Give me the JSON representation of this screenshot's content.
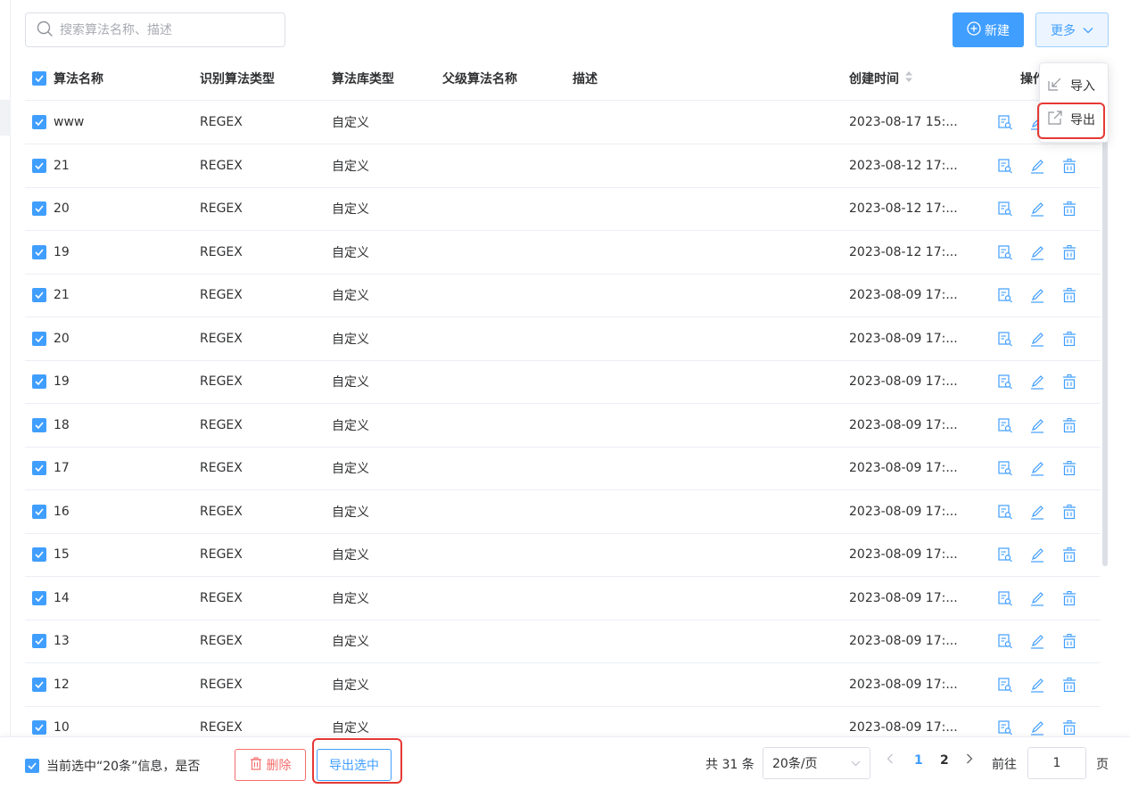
{
  "search": {
    "placeholder": "搜索算法名称、描述"
  },
  "toolbar": {
    "new_label": "新建",
    "more_label": "更多"
  },
  "more_menu": {
    "import_label": "导入",
    "export_label": "导出"
  },
  "table": {
    "columns": [
      "算法名称",
      "识别算法类型",
      "算法库类型",
      "父级算法名称",
      "描述",
      "创建时间",
      "操作"
    ],
    "rows": [
      {
        "name": "www",
        "type": "REGEX",
        "lib": "自定义",
        "parent": "",
        "desc": "",
        "time": "2023-08-17 15:..."
      },
      {
        "name": "21",
        "type": "REGEX",
        "lib": "自定义",
        "parent": "",
        "desc": "",
        "time": "2023-08-12 17:..."
      },
      {
        "name": "20",
        "type": "REGEX",
        "lib": "自定义",
        "parent": "",
        "desc": "",
        "time": "2023-08-12 17:..."
      },
      {
        "name": "19",
        "type": "REGEX",
        "lib": "自定义",
        "parent": "",
        "desc": "",
        "time": "2023-08-12 17:..."
      },
      {
        "name": "21",
        "type": "REGEX",
        "lib": "自定义",
        "parent": "",
        "desc": "",
        "time": "2023-08-09 17:..."
      },
      {
        "name": "20",
        "type": "REGEX",
        "lib": "自定义",
        "parent": "",
        "desc": "",
        "time": "2023-08-09 17:..."
      },
      {
        "name": "19",
        "type": "REGEX",
        "lib": "自定义",
        "parent": "",
        "desc": "",
        "time": "2023-08-09 17:..."
      },
      {
        "name": "18",
        "type": "REGEX",
        "lib": "自定义",
        "parent": "",
        "desc": "",
        "time": "2023-08-09 17:..."
      },
      {
        "name": "17",
        "type": "REGEX",
        "lib": "自定义",
        "parent": "",
        "desc": "",
        "time": "2023-08-09 17:..."
      },
      {
        "name": "16",
        "type": "REGEX",
        "lib": "自定义",
        "parent": "",
        "desc": "",
        "time": "2023-08-09 17:..."
      },
      {
        "name": "15",
        "type": "REGEX",
        "lib": "自定义",
        "parent": "",
        "desc": "",
        "time": "2023-08-09 17:..."
      },
      {
        "name": "14",
        "type": "REGEX",
        "lib": "自定义",
        "parent": "",
        "desc": "",
        "time": "2023-08-09 17:..."
      },
      {
        "name": "13",
        "type": "REGEX",
        "lib": "自定义",
        "parent": "",
        "desc": "",
        "time": "2023-08-09 17:..."
      },
      {
        "name": "12",
        "type": "REGEX",
        "lib": "自定义",
        "parent": "",
        "desc": "",
        "time": "2023-08-09 17:..."
      },
      {
        "name": "10",
        "type": "REGEX",
        "lib": "自定义",
        "parent": "",
        "desc": "",
        "time": "2023-08-09 17:..."
      }
    ]
  },
  "footer": {
    "selection_text": "当前选中“20条”信息，是否",
    "delete_label": "删除",
    "export_selected_label": "导出选中",
    "total_text": "共 31 条",
    "page_size": "20条/页",
    "pages": [
      "1",
      "2"
    ],
    "goto_label": "前往",
    "goto_value": "1",
    "page_unit": "页"
  },
  "colors": {
    "primary": "#409eff",
    "danger": "#f56c6c",
    "highlight": "#e53935"
  }
}
